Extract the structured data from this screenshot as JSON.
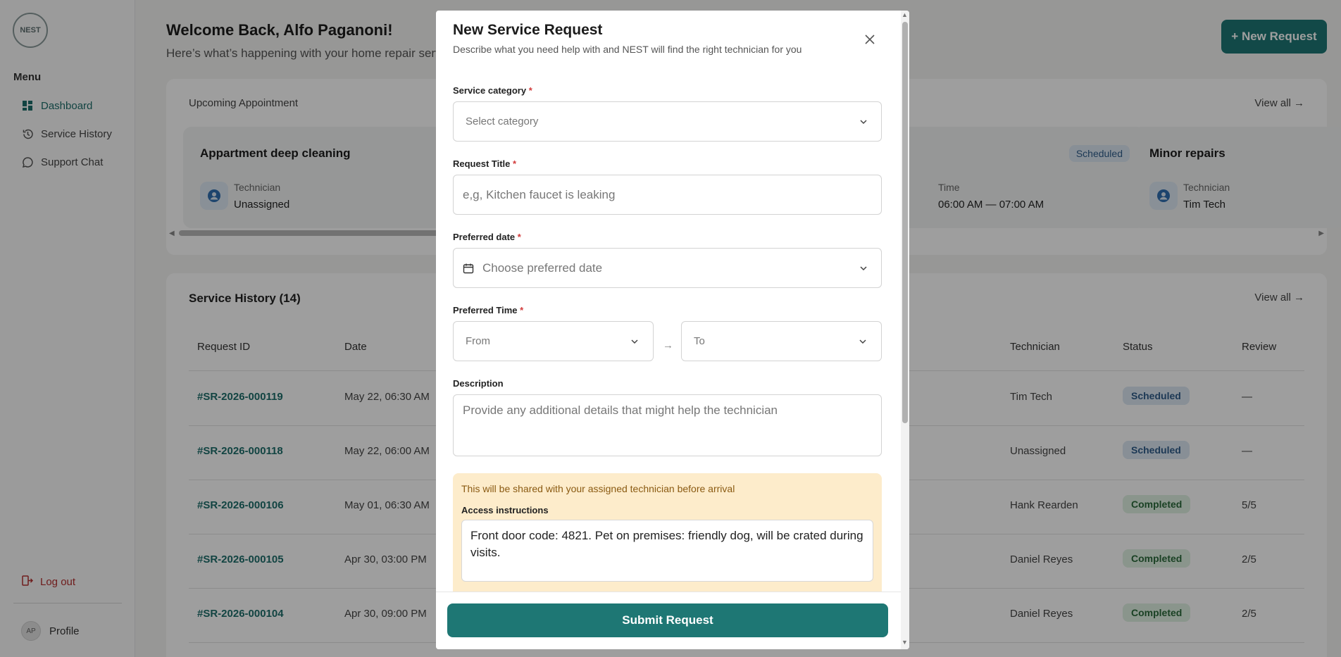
{
  "sidebar": {
    "logo_text": "NEST",
    "menu_title": "Menu",
    "items": [
      {
        "label": "Dashboard",
        "icon": "dashboard-icon"
      },
      {
        "label": "Service History",
        "icon": "history-icon"
      },
      {
        "label": "Support Chat",
        "icon": "chat-icon"
      }
    ],
    "logout_label": "Log out",
    "profile_initials": "AP",
    "profile_label": "Profile"
  },
  "header": {
    "welcome": "Welcome Back, Alfo Paganoni!",
    "subtitle": "Here’s what’s happening with your home repair serv",
    "new_request_label": "+ New Request"
  },
  "upcoming": {
    "label": "Upcoming Appointment",
    "view_all": "View all →",
    "cards": [
      {
        "title": "Appartment deep cleaning",
        "tech_label": "Technician",
        "tech_value": "Unassigned"
      },
      {
        "badge": "Scheduled",
        "time_label": "Time",
        "time_value": "06:00 AM — 07:00 AM"
      },
      {
        "title": "Minor repairs",
        "tech_label": "Technician",
        "tech_value": "Tim Tech"
      }
    ]
  },
  "history": {
    "title": "Service History (14)",
    "view_all": "View all →",
    "columns": [
      "Request ID",
      "Date",
      "Technician",
      "Status",
      "Review"
    ],
    "rows": [
      {
        "id": "#SR-2026-000119",
        "date": "May 22, 06:30 AM",
        "technician": "Tim Tech",
        "status": "Scheduled",
        "review": "—"
      },
      {
        "id": "#SR-2026-000118",
        "date": "May 22, 06:00 AM",
        "technician": "Unassigned",
        "status": "Scheduled",
        "review": "—"
      },
      {
        "id": "#SR-2026-000106",
        "date": "May 01, 06:30 AM",
        "technician": "Hank Rearden",
        "status": "Completed",
        "review": "5/5"
      },
      {
        "id": "#SR-2026-000105",
        "date": "Apr 30, 03:00 PM",
        "technician": "Daniel Reyes",
        "status": "Completed",
        "review": "2/5"
      },
      {
        "id": "#SR-2026-000104",
        "date": "Apr 30, 09:00 PM",
        "technician": "Daniel Reyes",
        "status": "Completed",
        "review": "2/5"
      }
    ]
  },
  "modal": {
    "title": "New Service Request",
    "subtitle": "Describe what you need help with and NEST will find the right technician for you",
    "category_label": "Service category",
    "category_placeholder": "Select category",
    "title_label": "Request Title",
    "title_placeholder": "e,g, Kitchen faucet is leaking",
    "date_label": "Preferred date",
    "date_placeholder": "Choose preferred date",
    "time_label": "Preferred Time",
    "time_from": "From",
    "time_to": "To",
    "description_label": "Description",
    "description_placeholder": "Provide any additional details that might help the technician",
    "notice": "This will be shared with your assigned technician before arrival",
    "access_label": "Access instructions",
    "access_value": "Front door code: 4821. Pet on premises: friendly dog, will be crated during visits.",
    "submit_label": "Submit Request",
    "required_marker": "*"
  },
  "colors": {
    "brand": "#1e7774",
    "link": "#1d6e6b",
    "logout": "#b43030",
    "scheduled_bg": "#dbe7f3",
    "completed_bg": "#dff0e2",
    "notice_bg": "#fdeccb"
  }
}
